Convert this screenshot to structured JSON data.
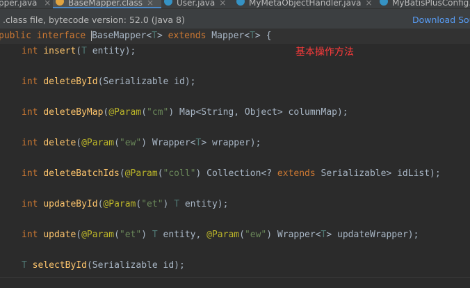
{
  "tabs": [
    {
      "label": "pper.java",
      "icon": "class-icon",
      "icon_color": "#3592c4",
      "active": false
    },
    {
      "label": "BaseMapper.class",
      "icon": "class-icon",
      "icon_color": "#e0a340",
      "active": true
    },
    {
      "label": "User.java",
      "icon": "class-icon",
      "icon_color": "#3592c4",
      "active": false
    },
    {
      "label": "MyMetaObjectHandler.java",
      "icon": "class-icon",
      "icon_color": "#3592c4",
      "active": false
    },
    {
      "label": "MyBatisPlusConfig.j",
      "icon": "class-icon",
      "icon_color": "#3592c4",
      "active": false
    }
  ],
  "tab_close_glyph": "×",
  "infobar": {
    "message": ".class file, bytecode version: 52.0 (Java 8)",
    "download_label": "Download Sou"
  },
  "code": {
    "header": {
      "public": "public",
      "interface": "interface",
      "name": "BaseMapper",
      "lt1": "<",
      "T1": "T",
      "gt1": ">",
      "extends": "extends",
      "mapper": "Mapper",
      "lt2": "<",
      "T2": "T",
      "gt2": ">",
      "brace": " {"
    },
    "lines": {
      "insert": {
        "int": "int",
        "name": "insert",
        "rest_open": "(",
        "T": "T",
        "rest": " entity);"
      },
      "deleteById": {
        "int": "int",
        "name": "deleteById",
        "rest": "(Serializable id);"
      },
      "deleteByMap": {
        "int": "int",
        "name": "deleteByMap",
        "p1": "(",
        "ann": "@Param",
        "p2": "(",
        "str": "\"cm\"",
        "rest": ") Map<String, Object> columnMap);"
      },
      "delete": {
        "int": "int",
        "name": "delete",
        "p1": "(",
        "ann": "@Param",
        "p2": "(",
        "str": "\"ew\"",
        "rest_a": ") Wrapper<",
        "T": "T",
        "rest_b": "> wrapper);"
      },
      "deleteBatchIds": {
        "int": "int",
        "name": "deleteBatchIds",
        "p1": "(",
        "ann": "@Param",
        "p2": "(",
        "str": "\"coll\"",
        "rest_a": ") Collection<? ",
        "extends": "extends",
        "rest_b": " Serializable> idList);"
      },
      "updateById": {
        "int": "int",
        "name": "updateById",
        "p1": "(",
        "ann": "@Param",
        "p2": "(",
        "str": "\"et\"",
        "rest_a": ") ",
        "T": "T",
        "rest_b": " entity);"
      },
      "update": {
        "int": "int",
        "name": "update",
        "p1": "(",
        "ann": "@Param",
        "p2": "(",
        "str": "\"et\"",
        "rest_a": ") ",
        "T": "T",
        "rest_b": " entity, ",
        "ann2": "@Param",
        "p3": "(",
        "str2": "\"ew\"",
        "rest_c": ") Wrapper<",
        "T2": "T",
        "rest_d": "> updateWrapper);"
      },
      "selectById": {
        "T": "T",
        "name": "selectById",
        "rest": "(Serializable id);"
      }
    }
  },
  "annotation_note": "基本操作方法",
  "colors": {
    "editor_bg": "#2b2b2b",
    "keyword": "#cc7832",
    "method": "#ffc66d",
    "annotation": "#bbb529",
    "string": "#6a8759",
    "type_param": "#507874",
    "note": "#ff3b3b",
    "link": "#589df6"
  }
}
